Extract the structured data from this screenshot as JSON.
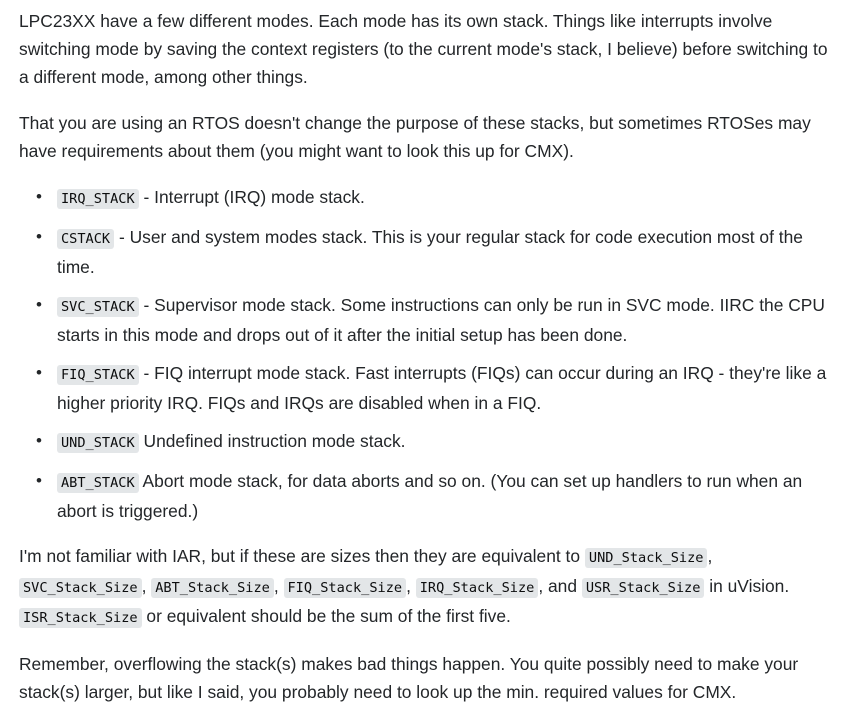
{
  "paragraphs": {
    "p1": "LPC23XX have a few different modes. Each mode has its own stack. Things like interrupts involve switching mode by saving the context registers (to the current mode's stack, I believe) before switching to a different mode, among other things.",
    "p2": "That you are using an RTOS doesn't change the purpose of these stacks, but sometimes RTOSes may have requirements about them (you might want to look this up for CMX).",
    "p4": "Remember, overflowing the stack(s) makes bad things happen. You quite possibly need to make your stack(s) larger, but like I said, you probably need to look up the min. required values for CMX."
  },
  "bullet_glyph": "•",
  "stack_list": [
    {
      "code": "IRQ_STACK",
      "text": " - Interrupt (IRQ) mode stack."
    },
    {
      "code": "CSTACK",
      "text": " - User and system modes stack. This is your regular stack for code execution most of the time."
    },
    {
      "code": "SVC_STACK",
      "text": " - Supervisor mode stack. Some instructions can only be run in SVC mode. IIRC the CPU starts in this mode and drops out of it after the initial setup has been done."
    },
    {
      "code": "FIQ_STACK",
      "text": " - FIQ interrupt mode stack. Fast interrupts (FIQs) can occur during an IRQ - they're like a higher priority IRQ. FIQs and IRQs are disabled when in a FIQ."
    },
    {
      "code": "UND_STACK",
      "text": " Undefined instruction mode stack."
    },
    {
      "code": "ABT_STACK",
      "text": " Abort mode stack, for data aborts and so on. (You can set up handlers to run when an abort is triggered.)"
    }
  ],
  "sizes_paragraph": {
    "t1": "I'm not familiar with IAR, but if these are sizes then they are equivalent to ",
    "c1": "UND_Stack_Size",
    "t2": ", ",
    "c2": "SVC_Stack_Size",
    "t3": ", ",
    "c3": "ABT_Stack_Size",
    "t4": ", ",
    "c4": "FIQ_Stack_Size",
    "t5": ", ",
    "c5": "IRQ_Stack_Size",
    "t6": ", and ",
    "c6": "USR_Stack_Size",
    "t7": " in uVision. ",
    "c7": "ISR_Stack_Size",
    "t8": " or equivalent should be the sum of the first five."
  }
}
